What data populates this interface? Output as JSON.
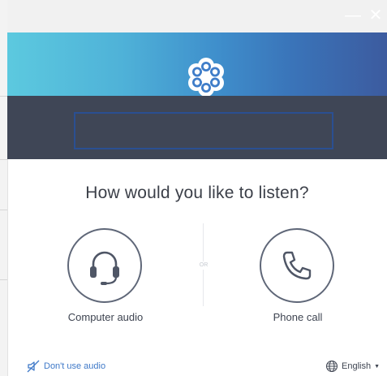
{
  "window": {
    "minimize_glyph": "—",
    "close_glyph": "✕"
  },
  "banner": {
    "logo_icon": "gotomeeting-flower-icon"
  },
  "main": {
    "heading": "How would you like to listen?",
    "divider_text": "OR",
    "options": [
      {
        "label": "Computer audio",
        "icon": "headset-icon"
      },
      {
        "label": "Phone call",
        "icon": "phone-icon"
      }
    ]
  },
  "footer": {
    "no_audio_label": "Don't use audio",
    "no_audio_icon": "muted-speaker-icon",
    "language": "English",
    "language_icon": "globe-icon"
  },
  "colors": {
    "accent_blue": "#3f79c8",
    "dark_band": "#3f4656",
    "field_border": "#2a4f92",
    "text_dark": "#3b3f48"
  }
}
